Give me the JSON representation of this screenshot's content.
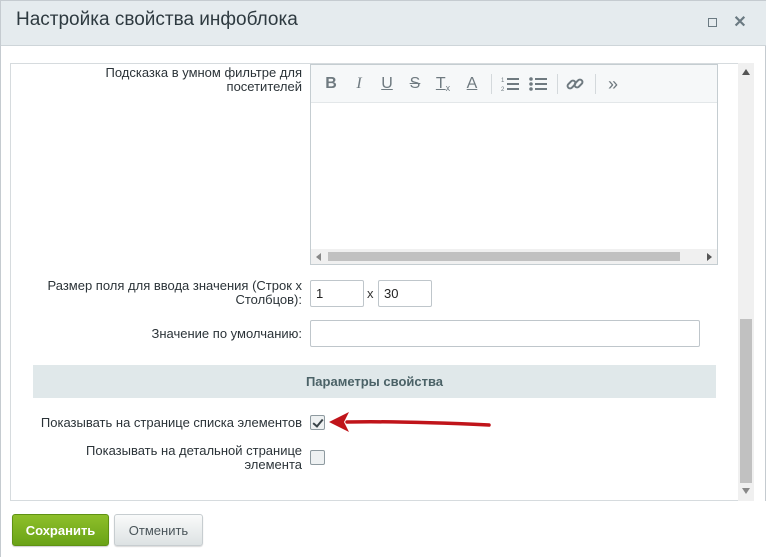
{
  "dialog": {
    "title": "Настройка свойства инфоблока",
    "maximize_icon": "maximize-icon",
    "close_icon": "close-icon"
  },
  "form": {
    "hint_label_line1": "Подсказка в умном фильтре для",
    "hint_label_line2": "посетителей",
    "size_label_line1": "Размер поля для ввода значения (Строк х",
    "size_label_line2": "Столбцов):",
    "rows_value": "1",
    "cols_separator": "x",
    "cols_value": "30",
    "default_label": "Значение по умолчанию:",
    "default_value": ""
  },
  "editor_toolbar": {
    "bold": "B",
    "italic": "I",
    "underline": "U",
    "strike": "S",
    "clear_format": "T",
    "font_color": "A",
    "icons": [
      "bold-icon",
      "italic-icon",
      "underline-icon",
      "strikethrough-icon",
      "remove-format-icon",
      "font-color-icon",
      "ordered-list-icon",
      "unordered-list-icon",
      "link-icon",
      "more-icon"
    ]
  },
  "section": {
    "title": "Параметры свойства"
  },
  "options": {
    "show_in_list_label": "Показывать на странице списка элементов",
    "show_in_list_checked": true,
    "show_in_detail_line1": "Показывать на детальной странице",
    "show_in_detail_line2": "элемента",
    "show_in_detail_checked": false
  },
  "footer": {
    "save_label": "Сохранить",
    "cancel_label": "Отменить"
  },
  "colors": {
    "save_button": "#7ab022",
    "annotation_arrow": "#c0141a",
    "titlebar": "#e5ebee",
    "section_header": "#e0e8ea"
  }
}
